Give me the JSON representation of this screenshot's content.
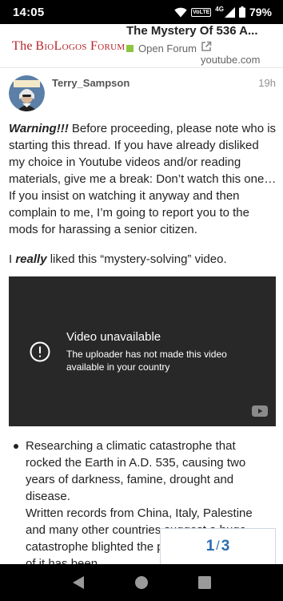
{
  "status_bar": {
    "time": "14:05",
    "volte": "VoLTE",
    "network": "4G",
    "battery": "79%"
  },
  "header": {
    "logo_prefix": "The",
    "logo_main": "BioLogos Forum",
    "topic_title": "The Mystery Of 536 A...",
    "category": "Open Forum",
    "category_color": "#8dc63f",
    "source": "youtube.com"
  },
  "post": {
    "username": "Terry_Sampson",
    "time_ago": "19h",
    "warning_label": "Warning!!!",
    "warning_text": " Before proceeding, please note who is starting this thread. If you have already disliked my choice in Youtube videos and/or reading materials, give me a break: Don’t watch this one… If you insist on watching it anyway and then complain to me, I’m going to report you to the mods for harassing a senior citizen.",
    "liked_prefix": "I ",
    "liked_emph": "really",
    "liked_suffix": " liked this “mystery-solving” video.",
    "video": {
      "title": "Video unavailable",
      "message": "The uploader has not made this video available in your country"
    },
    "bullets": [
      {
        "text": "Researching a climatic catastrophe that rocked the Earth in A.D. 535, causing two years of darkness, famine, drought and disease.",
        "continuation": "Written records from China, Italy, Palestine and many other countries suggest a huge catastrophe blighted the planet but the cause of it has been"
      }
    ]
  },
  "progress": {
    "current": "1",
    "separator": "/",
    "total": "3",
    "color": "#2b6cb0"
  },
  "nav": {
    "back": "back-icon",
    "home": "home-icon",
    "recents": "recents-icon"
  }
}
